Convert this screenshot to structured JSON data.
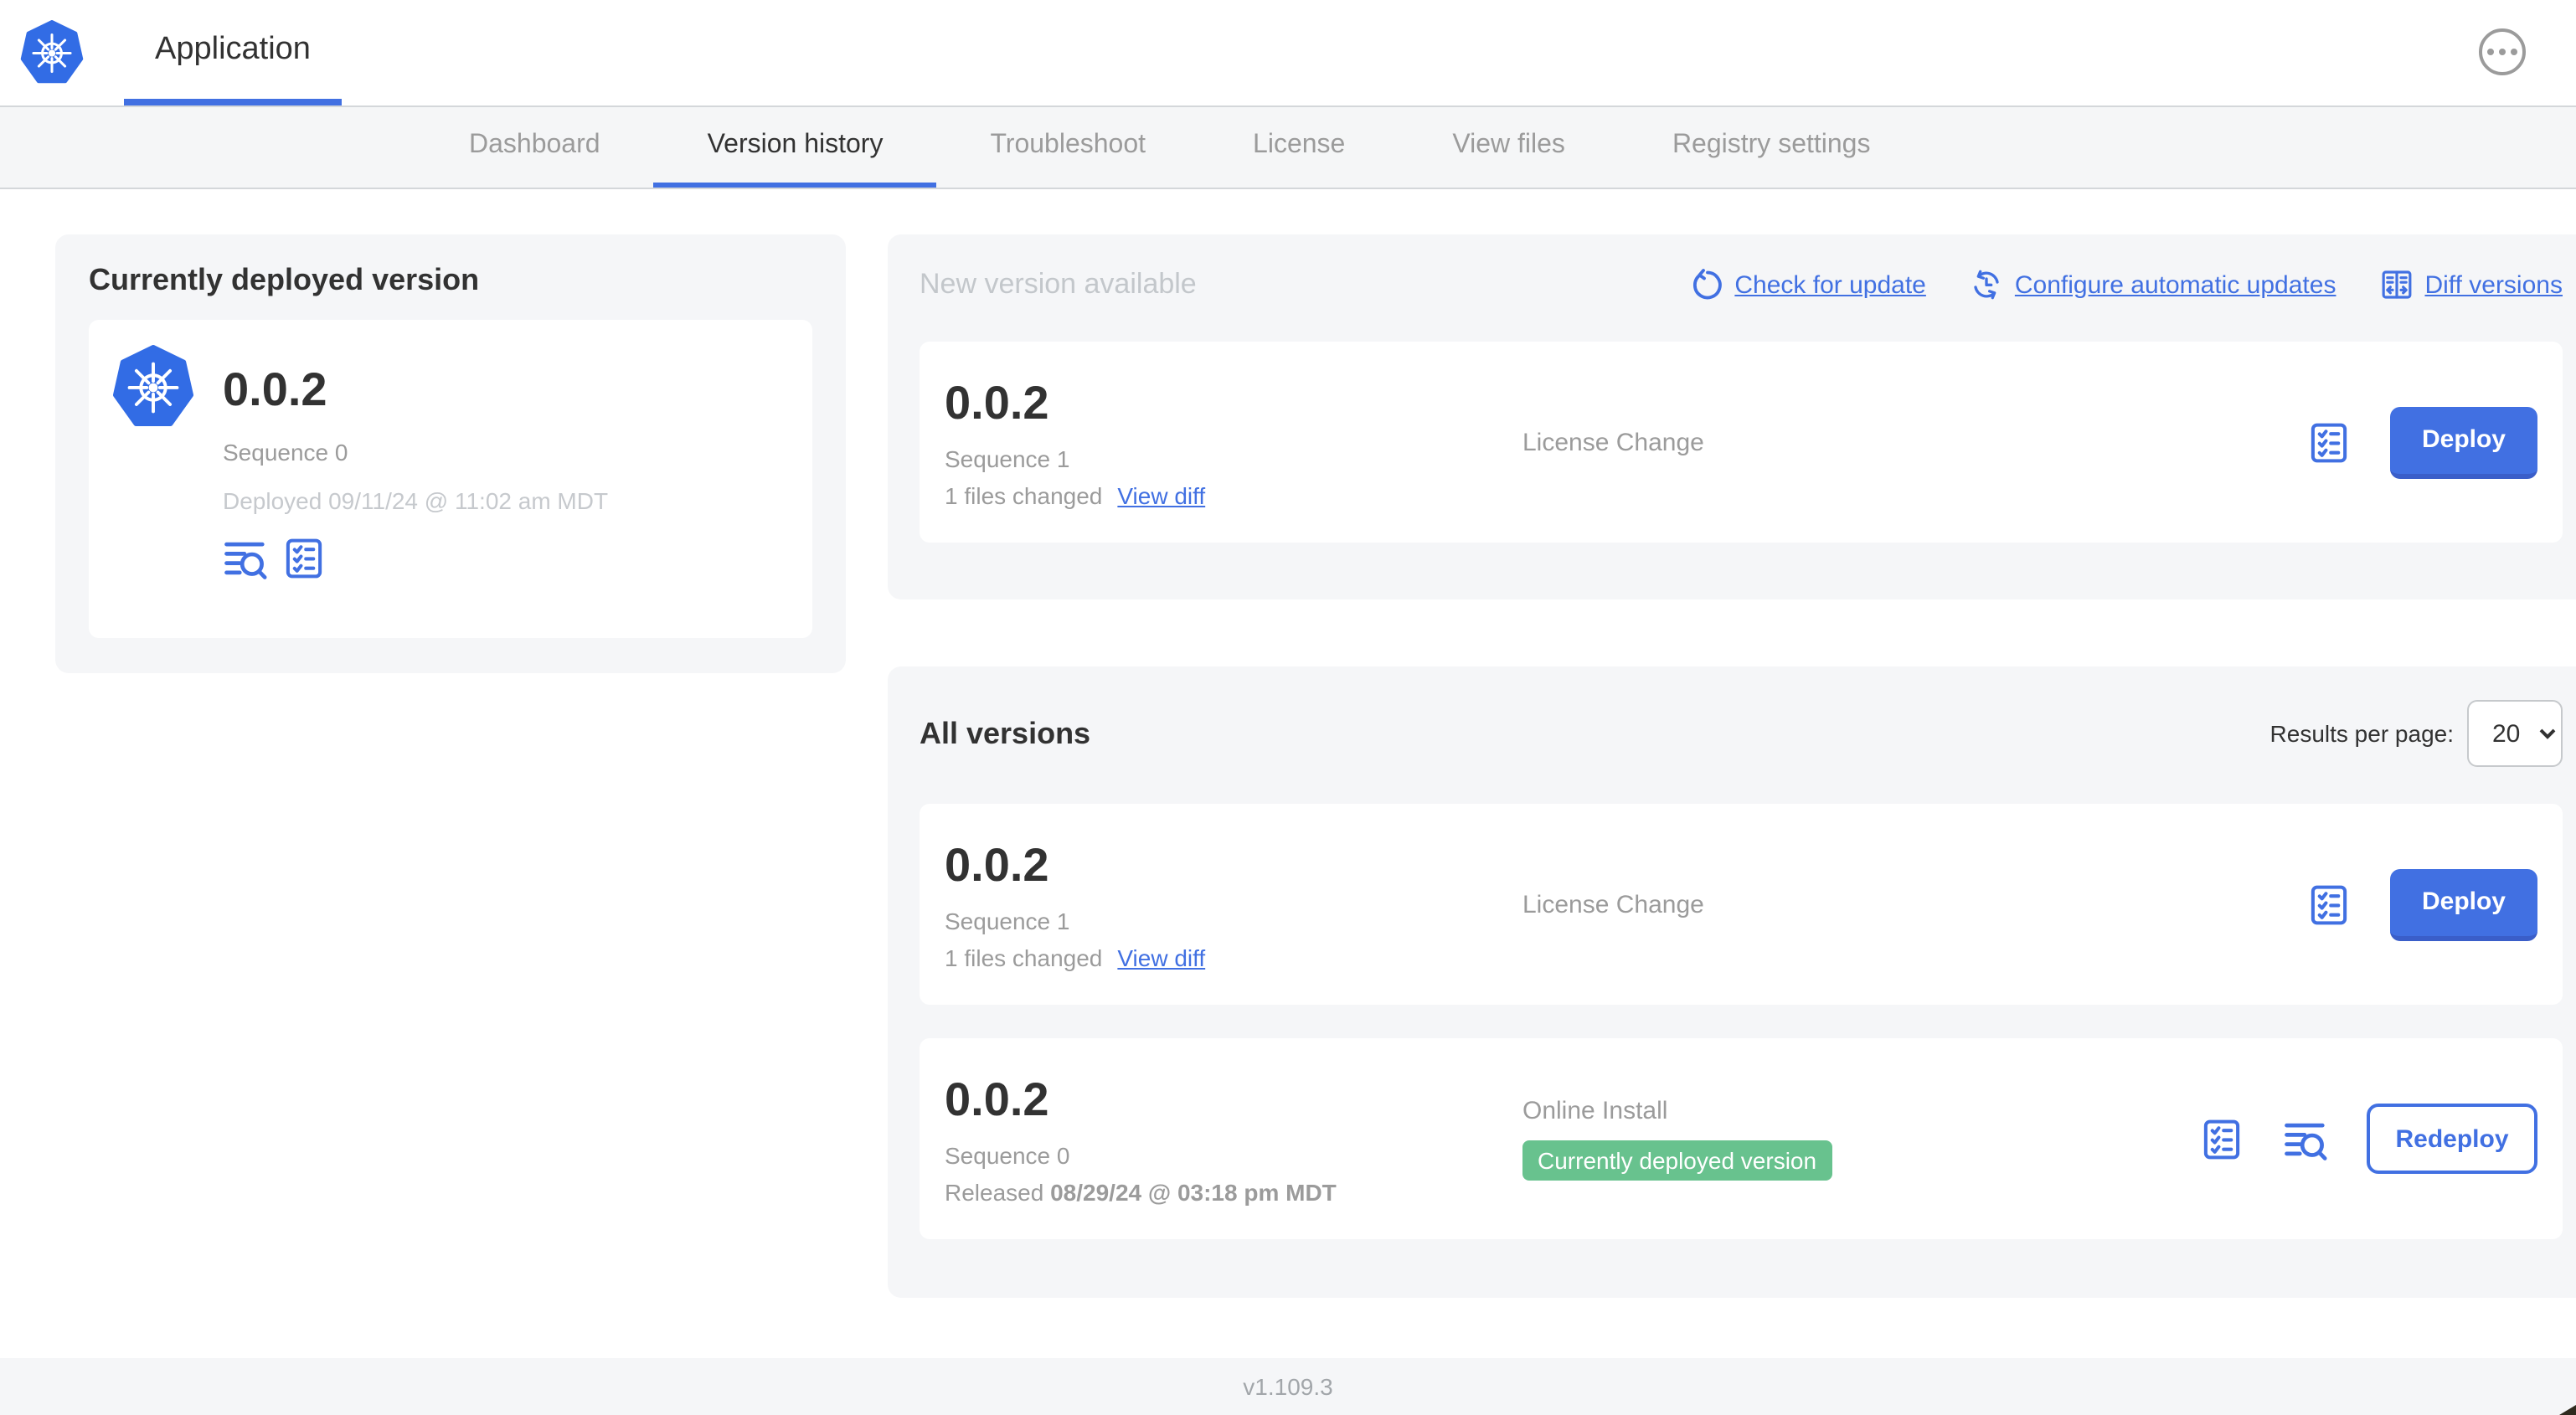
{
  "header": {
    "application_label": "Application"
  },
  "nav": {
    "tabs": [
      {
        "label": "Dashboard",
        "active": false
      },
      {
        "label": "Version history",
        "active": true
      },
      {
        "label": "Troubleshoot",
        "active": false
      },
      {
        "label": "License",
        "active": false
      },
      {
        "label": "View files",
        "active": false
      },
      {
        "label": "Registry settings",
        "active": false
      }
    ]
  },
  "current_deployed": {
    "title": "Currently deployed version",
    "version": "0.0.2",
    "sequence": "Sequence 0",
    "deployed": "Deployed 09/11/24 @ 11:02 am MDT"
  },
  "new_version": {
    "title": "New version available",
    "actions": [
      {
        "label": "Check for update",
        "icon": "refresh-icon"
      },
      {
        "label": "Configure automatic updates",
        "icon": "schedule-update-icon"
      },
      {
        "label": "Diff versions",
        "icon": "diff-icon"
      }
    ],
    "card": {
      "version": "0.0.2",
      "sequence": "Sequence 1",
      "files_changed": "1 files changed",
      "view_diff": "View diff",
      "source": "License Change",
      "action": "Deploy"
    }
  },
  "all_versions": {
    "title": "All versions",
    "results_per_page_label": "Results per page:",
    "results_per_page_value": "20",
    "rows": [
      {
        "version": "0.0.2",
        "sequence": "Sequence 1",
        "files_changed": "1 files changed",
        "view_diff": "View diff",
        "source": "License Change",
        "action": "Deploy"
      },
      {
        "version": "0.0.2",
        "sequence": "Sequence 0",
        "released_prefix": "Released ",
        "released_date": "08/29/24 @ 03:18 pm MDT",
        "source": "Online Install",
        "badge": "Currently deployed version",
        "action": "Redeploy"
      }
    ]
  },
  "footer": {
    "version": "v1.109.3"
  },
  "colors": {
    "accent_blue": "#4170e2",
    "kubernetes_blue": "#326ce5",
    "badge_green": "#68c28e",
    "panel_gray": "#f5f6f8"
  }
}
